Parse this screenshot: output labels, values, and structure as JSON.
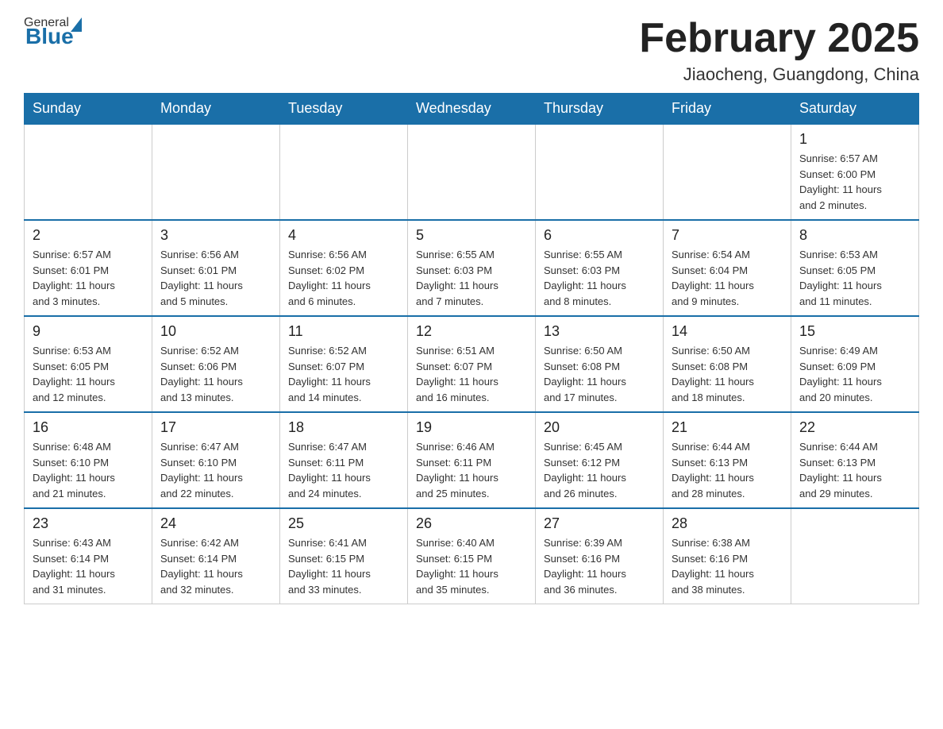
{
  "logo": {
    "general": "General",
    "blue": "Blue"
  },
  "header": {
    "title": "February 2025",
    "location": "Jiaocheng, Guangdong, China"
  },
  "weekdays": [
    "Sunday",
    "Monday",
    "Tuesday",
    "Wednesday",
    "Thursday",
    "Friday",
    "Saturday"
  ],
  "weeks": [
    [
      {
        "day": "",
        "info": ""
      },
      {
        "day": "",
        "info": ""
      },
      {
        "day": "",
        "info": ""
      },
      {
        "day": "",
        "info": ""
      },
      {
        "day": "",
        "info": ""
      },
      {
        "day": "",
        "info": ""
      },
      {
        "day": "1",
        "info": "Sunrise: 6:57 AM\nSunset: 6:00 PM\nDaylight: 11 hours\nand 2 minutes."
      }
    ],
    [
      {
        "day": "2",
        "info": "Sunrise: 6:57 AM\nSunset: 6:01 PM\nDaylight: 11 hours\nand 3 minutes."
      },
      {
        "day": "3",
        "info": "Sunrise: 6:56 AM\nSunset: 6:01 PM\nDaylight: 11 hours\nand 5 minutes."
      },
      {
        "day": "4",
        "info": "Sunrise: 6:56 AM\nSunset: 6:02 PM\nDaylight: 11 hours\nand 6 minutes."
      },
      {
        "day": "5",
        "info": "Sunrise: 6:55 AM\nSunset: 6:03 PM\nDaylight: 11 hours\nand 7 minutes."
      },
      {
        "day": "6",
        "info": "Sunrise: 6:55 AM\nSunset: 6:03 PM\nDaylight: 11 hours\nand 8 minutes."
      },
      {
        "day": "7",
        "info": "Sunrise: 6:54 AM\nSunset: 6:04 PM\nDaylight: 11 hours\nand 9 minutes."
      },
      {
        "day": "8",
        "info": "Sunrise: 6:53 AM\nSunset: 6:05 PM\nDaylight: 11 hours\nand 11 minutes."
      }
    ],
    [
      {
        "day": "9",
        "info": "Sunrise: 6:53 AM\nSunset: 6:05 PM\nDaylight: 11 hours\nand 12 minutes."
      },
      {
        "day": "10",
        "info": "Sunrise: 6:52 AM\nSunset: 6:06 PM\nDaylight: 11 hours\nand 13 minutes."
      },
      {
        "day": "11",
        "info": "Sunrise: 6:52 AM\nSunset: 6:07 PM\nDaylight: 11 hours\nand 14 minutes."
      },
      {
        "day": "12",
        "info": "Sunrise: 6:51 AM\nSunset: 6:07 PM\nDaylight: 11 hours\nand 16 minutes."
      },
      {
        "day": "13",
        "info": "Sunrise: 6:50 AM\nSunset: 6:08 PM\nDaylight: 11 hours\nand 17 minutes."
      },
      {
        "day": "14",
        "info": "Sunrise: 6:50 AM\nSunset: 6:08 PM\nDaylight: 11 hours\nand 18 minutes."
      },
      {
        "day": "15",
        "info": "Sunrise: 6:49 AM\nSunset: 6:09 PM\nDaylight: 11 hours\nand 20 minutes."
      }
    ],
    [
      {
        "day": "16",
        "info": "Sunrise: 6:48 AM\nSunset: 6:10 PM\nDaylight: 11 hours\nand 21 minutes."
      },
      {
        "day": "17",
        "info": "Sunrise: 6:47 AM\nSunset: 6:10 PM\nDaylight: 11 hours\nand 22 minutes."
      },
      {
        "day": "18",
        "info": "Sunrise: 6:47 AM\nSunset: 6:11 PM\nDaylight: 11 hours\nand 24 minutes."
      },
      {
        "day": "19",
        "info": "Sunrise: 6:46 AM\nSunset: 6:11 PM\nDaylight: 11 hours\nand 25 minutes."
      },
      {
        "day": "20",
        "info": "Sunrise: 6:45 AM\nSunset: 6:12 PM\nDaylight: 11 hours\nand 26 minutes."
      },
      {
        "day": "21",
        "info": "Sunrise: 6:44 AM\nSunset: 6:13 PM\nDaylight: 11 hours\nand 28 minutes."
      },
      {
        "day": "22",
        "info": "Sunrise: 6:44 AM\nSunset: 6:13 PM\nDaylight: 11 hours\nand 29 minutes."
      }
    ],
    [
      {
        "day": "23",
        "info": "Sunrise: 6:43 AM\nSunset: 6:14 PM\nDaylight: 11 hours\nand 31 minutes."
      },
      {
        "day": "24",
        "info": "Sunrise: 6:42 AM\nSunset: 6:14 PM\nDaylight: 11 hours\nand 32 minutes."
      },
      {
        "day": "25",
        "info": "Sunrise: 6:41 AM\nSunset: 6:15 PM\nDaylight: 11 hours\nand 33 minutes."
      },
      {
        "day": "26",
        "info": "Sunrise: 6:40 AM\nSunset: 6:15 PM\nDaylight: 11 hours\nand 35 minutes."
      },
      {
        "day": "27",
        "info": "Sunrise: 6:39 AM\nSunset: 6:16 PM\nDaylight: 11 hours\nand 36 minutes."
      },
      {
        "day": "28",
        "info": "Sunrise: 6:38 AM\nSunset: 6:16 PM\nDaylight: 11 hours\nand 38 minutes."
      },
      {
        "day": "",
        "info": ""
      }
    ]
  ]
}
